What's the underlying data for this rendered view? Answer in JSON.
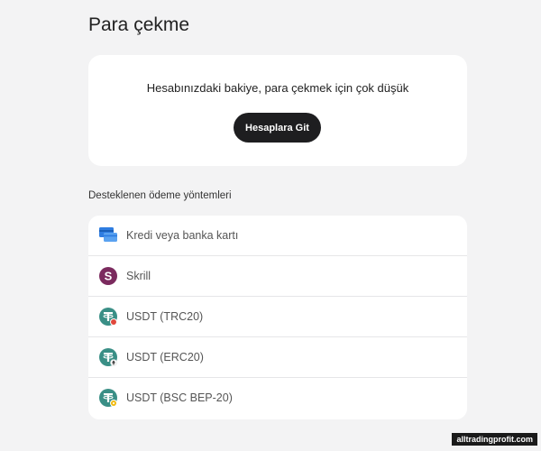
{
  "page": {
    "title": "Para çekme"
  },
  "balance": {
    "message": "Hesabınızdaki bakiye, para çekmek için çok düşük",
    "button_label": "Hesaplara Git"
  },
  "methods": {
    "title": "Desteklenen ödeme yöntemleri",
    "items": [
      {
        "label": "Kredi veya banka kartı",
        "icon": "card-icon"
      },
      {
        "label": "Skrill",
        "icon": "skrill-icon"
      },
      {
        "label": "USDT (TRC20)",
        "icon": "tether-trc20-icon"
      },
      {
        "label": "USDT (ERC20)",
        "icon": "tether-erc20-icon"
      },
      {
        "label": "USDT (BSC BEP-20)",
        "icon": "tether-bep20-icon"
      }
    ]
  },
  "watermark": {
    "text": "alltradingprofit.com"
  },
  "colors": {
    "background": "#f3f3f4",
    "card": "#ffffff",
    "button": "#1e1e20",
    "skrill": "#7b2a5e",
    "tether": "#3a8f86",
    "trc_badge": "#e0483c",
    "bep_badge": "#f0b90b"
  }
}
